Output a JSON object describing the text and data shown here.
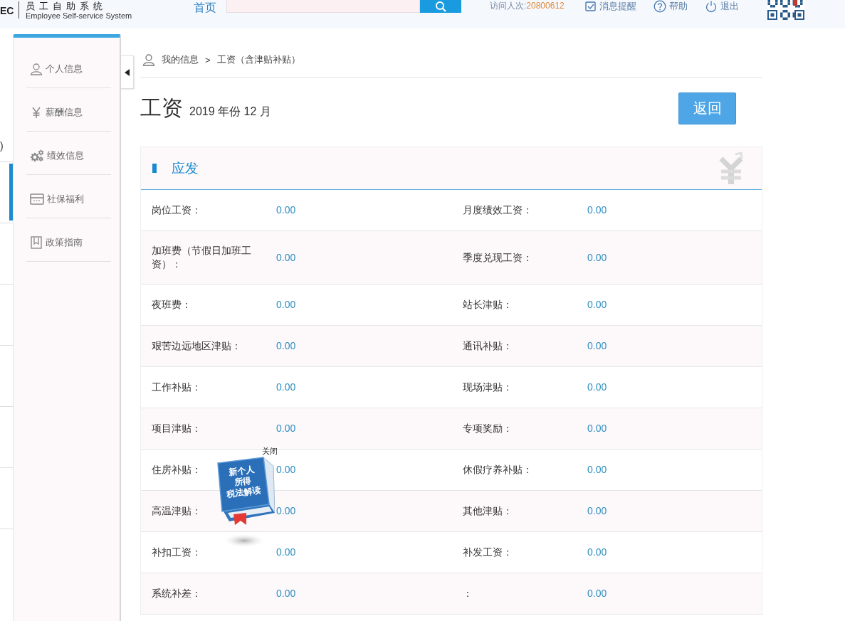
{
  "header": {
    "logo_text": "EC",
    "system_name": "员工自助系统",
    "system_name_en": "Employee Self-service System",
    "nav_link": "首页",
    "visits": {
      "label": "访问人次:",
      "value": "20800612"
    },
    "links": [
      {
        "label": "消息提醒",
        "kind": "message"
      },
      {
        "label": "帮助",
        "kind": "help"
      },
      {
        "label": "退出",
        "kind": "logout"
      }
    ]
  },
  "background_panel": {
    "text": ")"
  },
  "sidebar": {
    "items": [
      {
        "label": "个人信息",
        "kind": "person",
        "selected": false
      },
      {
        "label": "薪酬信息",
        "kind": "yen",
        "selected": false
      },
      {
        "label": "绩效信息",
        "kind": "gears",
        "selected": false
      },
      {
        "label": "社保福利",
        "kind": "card",
        "selected": false
      },
      {
        "label": "政策指南",
        "kind": "book",
        "selected": false
      }
    ]
  },
  "breadcrumb": {
    "items": [
      "我的信息",
      "工资（含津贴补贴）"
    ],
    "separator": ">"
  },
  "page_title": {
    "title": "工资",
    "subtitle": "2019 年份 12 月"
  },
  "back_button": {
    "label": "返回"
  },
  "section": {
    "title": "应发",
    "rows": [
      {
        "items": [
          {
            "label": "岗位工资：",
            "value": "0.00"
          },
          {
            "label": "月度绩效工资：",
            "value": "0.00"
          }
        ]
      },
      {
        "items": [
          {
            "label": "加班费（节假日加班工资）：",
            "value": "0.00"
          },
          {
            "label": "季度兑现工资：",
            "value": "0.00"
          }
        ]
      },
      {
        "items": [
          {
            "label": "夜班费：",
            "value": "0.00"
          },
          {
            "label": "站长津贴：",
            "value": "0.00"
          }
        ]
      },
      {
        "items": [
          {
            "label": "艰苦边远地区津贴：",
            "value": "0.00"
          },
          {
            "label": "通讯补贴：",
            "value": "0.00"
          }
        ]
      },
      {
        "items": [
          {
            "label": "工作补贴：",
            "value": "0.00"
          },
          {
            "label": "现场津贴：",
            "value": "0.00"
          }
        ]
      },
      {
        "items": [
          {
            "label": "项目津贴：",
            "value": "0.00"
          },
          {
            "label": "专项奖励：",
            "value": "0.00"
          }
        ]
      },
      {
        "items": [
          {
            "label": "住房补贴：",
            "value": "0.00"
          },
          {
            "label": "休假疗养补贴：",
            "value": "0.00"
          }
        ]
      },
      {
        "items": [
          {
            "label": "高温津贴：",
            "value": "0.00"
          },
          {
            "label": "其他津贴：",
            "value": "0.00"
          }
        ]
      },
      {
        "items": [
          {
            "label": "补扣工资：",
            "value": "0.00"
          },
          {
            "label": "补发工资：",
            "value": "0.00"
          }
        ]
      },
      {
        "items": [
          {
            "label": "系统补差：",
            "value": "0.00"
          },
          {
            "label": "：",
            "value": "0.00"
          }
        ]
      }
    ]
  },
  "book_widget": {
    "close_label": "关闭",
    "cover_lines": [
      "新个人",
      "所得",
      "税法解读"
    ]
  }
}
